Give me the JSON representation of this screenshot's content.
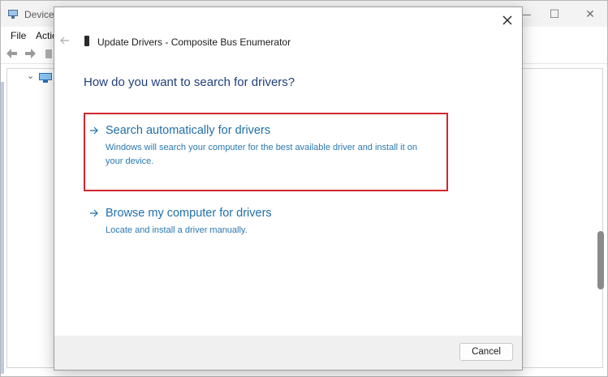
{
  "background_window": {
    "title": "Device",
    "menu": [
      "File",
      "Actic"
    ],
    "caption_minimize": "—",
    "caption_maximize": "☐",
    "caption_close": "✕",
    "tree_expander": "⌄"
  },
  "dialog": {
    "title": "Update Drivers - Composite Bus Enumerator",
    "question": "How do you want to search for drivers?",
    "options": [
      {
        "title": "Search automatically for drivers",
        "description": "Windows will search your computer for the best available driver and install it on your device."
      },
      {
        "title": "Browse my computer for drivers",
        "description": "Locate and install a driver manually."
      }
    ],
    "cancel_label": "Cancel"
  },
  "colors": {
    "link_blue": "#1f6fa8",
    "heading_blue": "#1f3f79",
    "highlight_red": "#d1262e"
  }
}
